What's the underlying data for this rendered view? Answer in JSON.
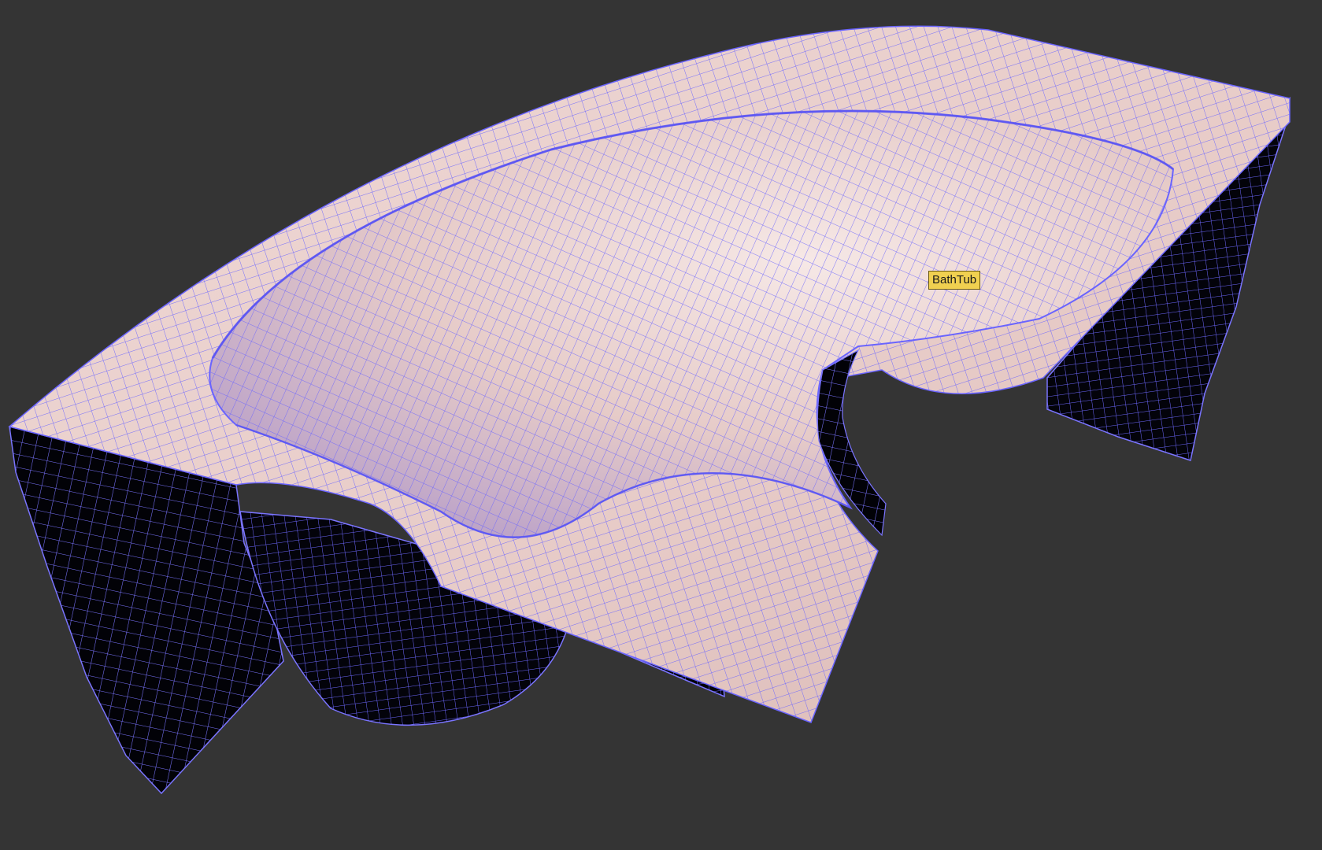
{
  "viewport": {
    "background": "#343434",
    "render_mode": "shaded-wireframe"
  },
  "object": {
    "name": "BathTub",
    "wire_color": "#6a64ff",
    "surface_color": "#ead0cc"
  },
  "tooltip": {
    "label": "BathTub"
  }
}
